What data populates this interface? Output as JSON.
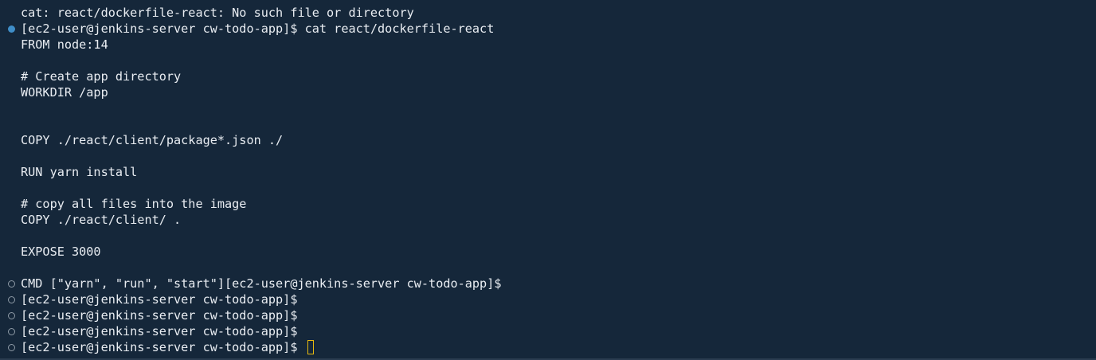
{
  "terminal": {
    "lines": [
      {
        "text": "cat: react/dockerfile-react: No such file or directory",
        "decoration": ""
      },
      {
        "text": "[ec2-user@jenkins-server cw-todo-app]$ cat react/dockerfile-react",
        "decoration": "success"
      },
      {
        "text": "FROM node:14",
        "decoration": ""
      },
      {
        "text": "",
        "decoration": ""
      },
      {
        "text": "# Create app directory",
        "decoration": ""
      },
      {
        "text": "WORKDIR /app",
        "decoration": ""
      },
      {
        "text": "",
        "decoration": ""
      },
      {
        "text": "",
        "decoration": ""
      },
      {
        "text": "COPY ./react/client/package*.json ./",
        "decoration": ""
      },
      {
        "text": "",
        "decoration": ""
      },
      {
        "text": "RUN yarn install",
        "decoration": ""
      },
      {
        "text": "",
        "decoration": ""
      },
      {
        "text": "# copy all files into the image",
        "decoration": ""
      },
      {
        "text": "COPY ./react/client/ .",
        "decoration": ""
      },
      {
        "text": "",
        "decoration": ""
      },
      {
        "text": "EXPOSE 3000",
        "decoration": ""
      },
      {
        "text": "",
        "decoration": ""
      },
      {
        "text": "CMD [\"yarn\", \"run\", \"start\"][ec2-user@jenkins-server cw-todo-app]$",
        "decoration": "default"
      },
      {
        "text": "[ec2-user@jenkins-server cw-todo-app]$",
        "decoration": "default"
      },
      {
        "text": "[ec2-user@jenkins-server cw-todo-app]$",
        "decoration": "default"
      },
      {
        "text": "[ec2-user@jenkins-server cw-todo-app]$",
        "decoration": "default"
      },
      {
        "text": "[ec2-user@jenkins-server cw-todo-app]$ ",
        "decoration": "default",
        "cursor": true
      }
    ]
  },
  "colors": {
    "background": "#15273a",
    "foreground": "#e9edf2",
    "success_decoration": "#3f8ec8",
    "default_decoration": "#8e9aa6",
    "cursor": "#e8b90e"
  },
  "icons": {
    "success_decoration": "command-success-dot-icon",
    "default_decoration": "command-default-circle-icon",
    "cursor": "text-cursor-icon"
  }
}
